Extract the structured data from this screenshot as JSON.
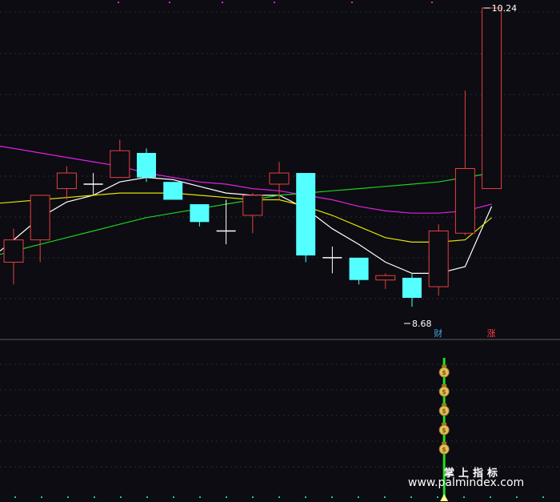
{
  "chart_data": {
    "type": "candlestick",
    "price_range": [
      8.4,
      10.3
    ],
    "grid": true,
    "candles": [
      {
        "o": 9.1,
        "h": 9.25,
        "l": 9.0,
        "c": 9.2
      },
      {
        "o": 9.2,
        "h": 9.4,
        "l": 9.1,
        "c": 9.4
      },
      {
        "o": 9.43,
        "h": 9.53,
        "l": 9.38,
        "c": 9.5
      },
      {
        "o": 9.45,
        "h": 9.5,
        "l": 9.4,
        "c": 9.45
      },
      {
        "o": 9.48,
        "h": 9.65,
        "l": 9.48,
        "c": 9.6
      },
      {
        "o": 9.59,
        "h": 9.61,
        "l": 9.46,
        "c": 9.48
      },
      {
        "o": 9.46,
        "h": 9.46,
        "l": 9.38,
        "c": 9.38
      },
      {
        "o": 9.36,
        "h": 9.36,
        "l": 9.26,
        "c": 9.28
      },
      {
        "o": 9.24,
        "h": 9.38,
        "l": 9.18,
        "c": 9.24
      },
      {
        "o": 9.31,
        "h": 9.41,
        "l": 9.23,
        "c": 9.4
      },
      {
        "o": 9.45,
        "h": 9.55,
        "l": 9.38,
        "c": 9.5
      },
      {
        "o": 9.5,
        "h": 9.5,
        "l": 9.1,
        "c": 9.13
      },
      {
        "o": 9.12,
        "h": 9.17,
        "l": 9.05,
        "c": 9.12
      },
      {
        "o": 9.12,
        "h": 9.12,
        "l": 9.0,
        "c": 9.02
      },
      {
        "o": 9.02,
        "h": 9.05,
        "l": 8.98,
        "c": 9.04
      },
      {
        "o": 9.03,
        "h": 9.05,
        "l": 8.9,
        "c": 8.94
      },
      {
        "o": 8.99,
        "h": 9.27,
        "l": 8.95,
        "c": 9.24
      },
      {
        "o": 9.23,
        "h": 9.87,
        "l": 9.22,
        "c": 9.52
      },
      {
        "o": 9.43,
        "h": 10.24,
        "l": 9.43,
        "c": 10.24
      }
    ],
    "ma_series": [
      {
        "color": "#ffffff",
        "values": [
          9.2,
          9.3,
          9.37,
          9.4,
          9.46,
          9.48,
          9.47,
          9.44,
          9.41,
          9.4,
          9.4,
          9.34,
          9.25,
          9.18,
          9.1,
          9.05,
          9.05,
          9.08,
          9.35
        ]
      },
      {
        "color": "#e4e400",
        "values": [
          9.37,
          9.38,
          9.39,
          9.4,
          9.41,
          9.41,
          9.41,
          9.4,
          9.39,
          9.38,
          9.38,
          9.35,
          9.31,
          9.26,
          9.21,
          9.19,
          9.19,
          9.2,
          9.3
        ]
      },
      {
        "color": "#e020e0",
        "values": [
          9.61,
          9.59,
          9.57,
          9.55,
          9.53,
          9.5,
          9.48,
          9.46,
          9.45,
          9.43,
          9.42,
          9.4,
          9.38,
          9.35,
          9.33,
          9.32,
          9.32,
          9.33,
          9.36
        ]
      },
      {
        "color": "#20d020",
        "values": [
          9.15,
          9.18,
          9.21,
          9.24,
          9.27,
          9.3,
          9.32,
          9.34,
          9.36,
          9.38,
          9.4,
          9.41,
          9.42,
          9.43,
          9.44,
          9.45,
          9.46,
          9.48,
          9.5
        ]
      }
    ],
    "annotations": [
      {
        "label": "10.24",
        "candle": 18,
        "price": 10.24
      },
      {
        "label": "8.68",
        "candle": 15,
        "price": 8.94
      }
    ],
    "markers": [
      {
        "label": "财",
        "candle": 16,
        "color": "#4aa0e0"
      },
      {
        "label": "涨",
        "candle": 18,
        "color": "#ff4040"
      }
    ],
    "signal": {
      "candle": 16,
      "coin_count": 5
    }
  },
  "watermark": {
    "cn": "掌上指标",
    "url": "www.palmindex.com"
  }
}
